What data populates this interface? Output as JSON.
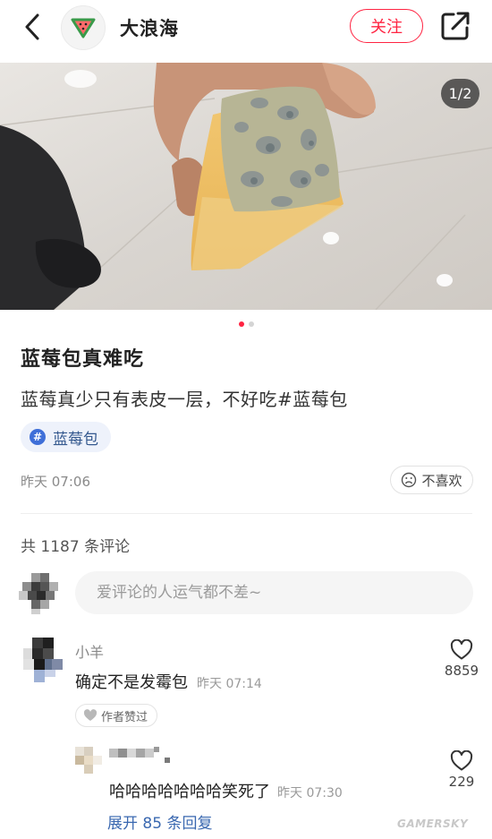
{
  "header": {
    "author_name": "大浪海",
    "follow_label": "关注"
  },
  "photo": {
    "page_counter": "1/2"
  },
  "carousel": {
    "total": 2,
    "active_index": 0
  },
  "post": {
    "title": "蓝莓包真难吃",
    "description": "蓝莓真少只有表皮一层，不好吃#蓝莓包",
    "tag": "蓝莓包",
    "time": "昨天 07:06",
    "dislike_label": "不喜欢"
  },
  "comments": {
    "count_text": "共 1187 条评论",
    "input_placeholder": "爱评论的人运气都不差~",
    "items": [
      {
        "user": "小羊",
        "text": "确定不是发霉包",
        "time": "昨天 07:14",
        "likes": "8859",
        "badge": "作者赞过"
      }
    ],
    "reply": {
      "text": "哈哈哈哈哈哈哈笑死了",
      "time": "昨天 07:30",
      "likes": "229"
    },
    "expand_label": "展开 85 条回复"
  },
  "watermark": "GAMERSKY",
  "colors": {
    "accent": "#ff2442",
    "link": "#3a68b0",
    "tag_bg": "#eef2fb"
  }
}
